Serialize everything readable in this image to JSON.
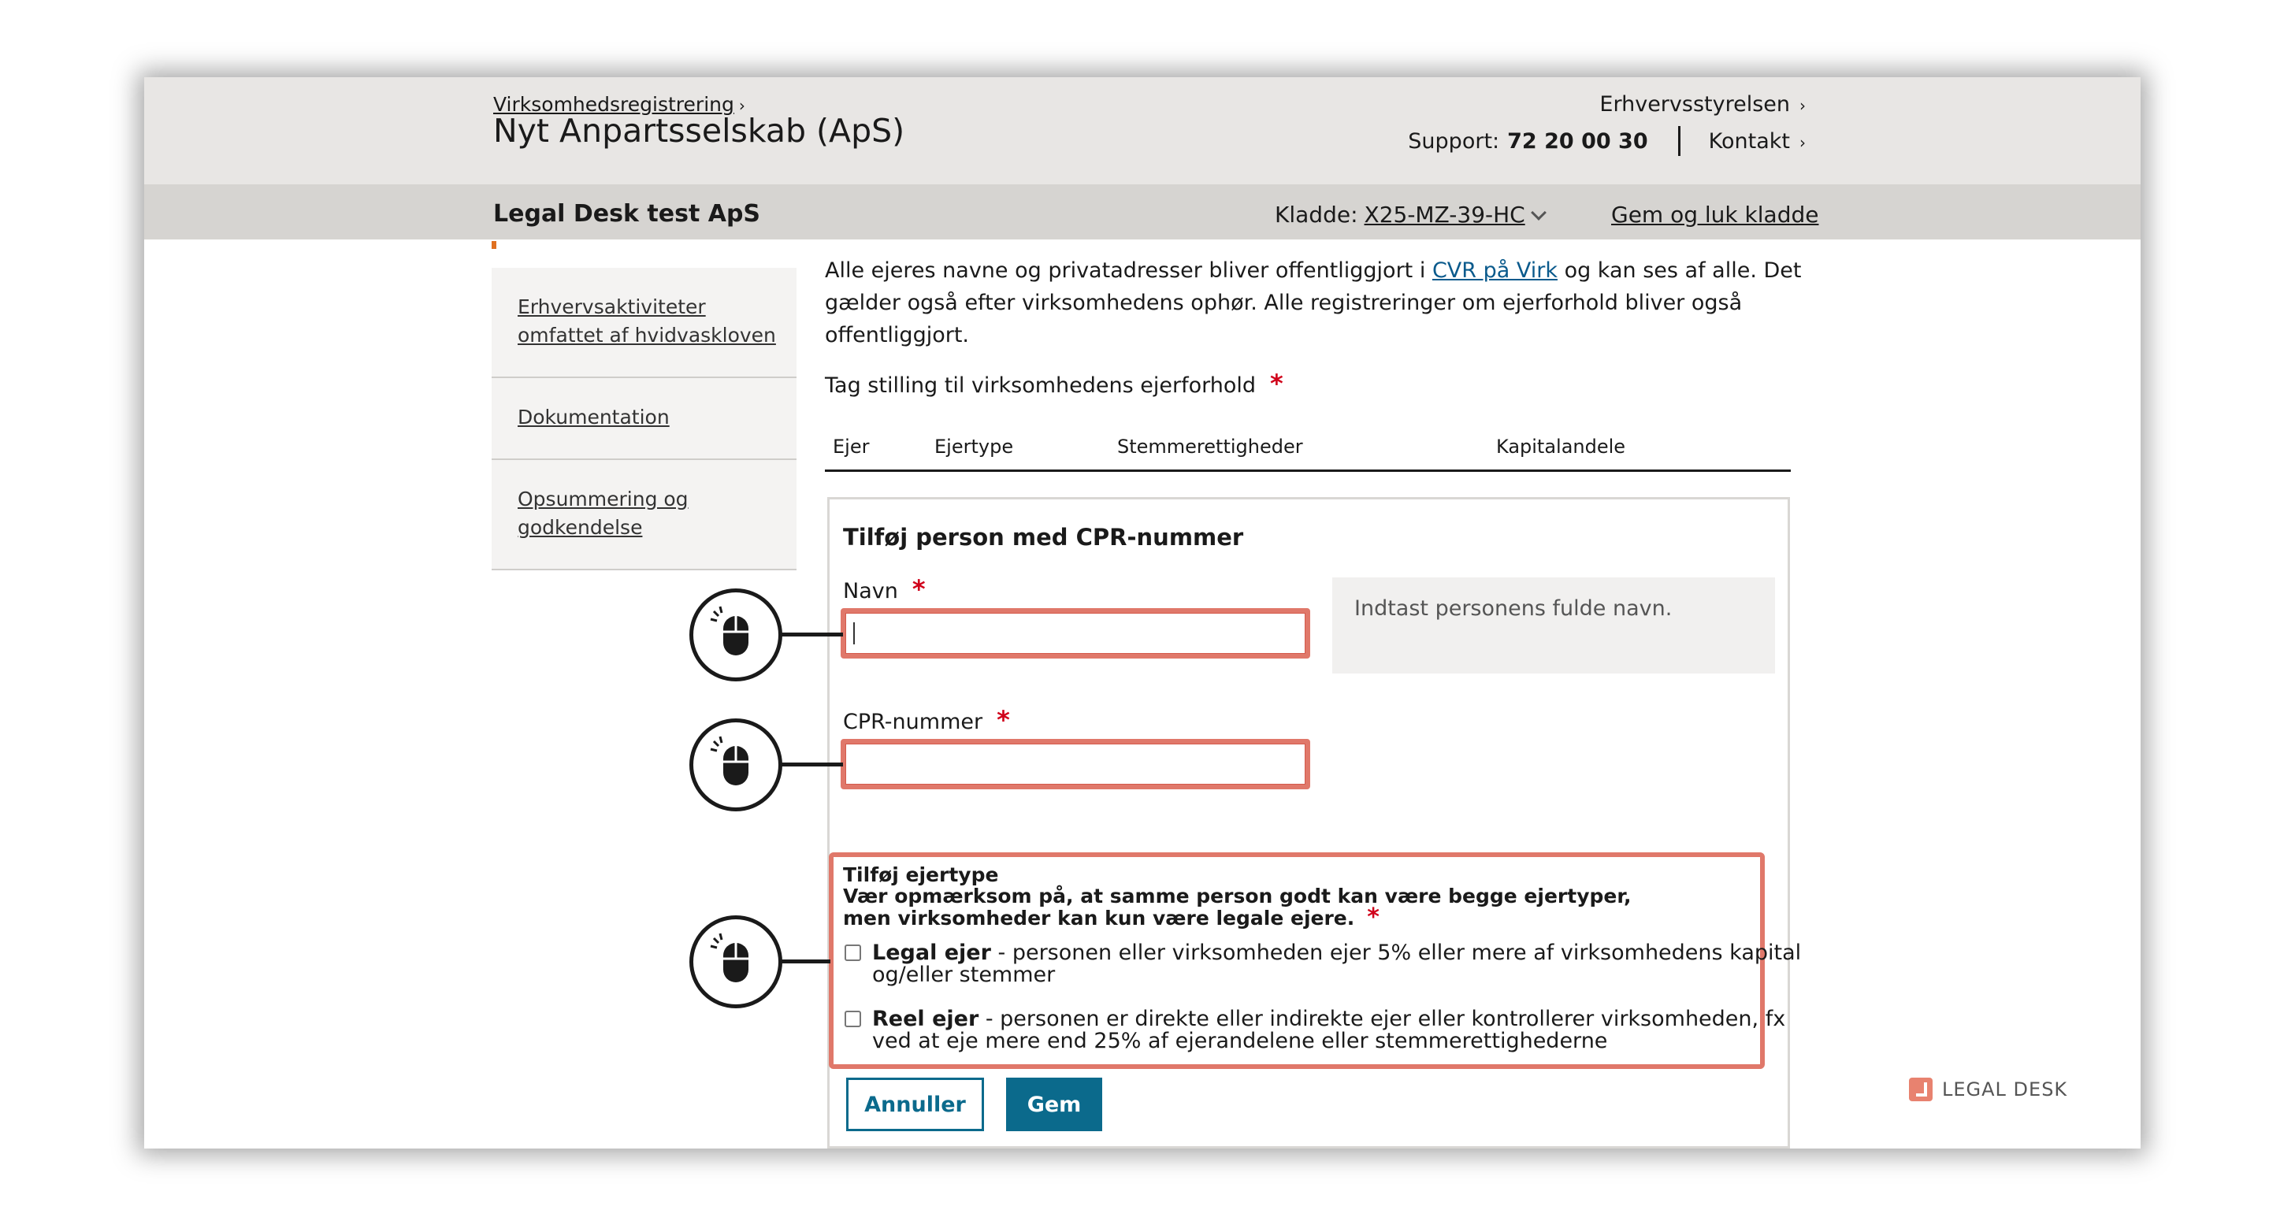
{
  "header": {
    "breadcrumb": "Virksomhedsregistrering",
    "title": "Nyt Anpartsselskab (ApS)",
    "org_link": "Erhvervsstyrelsen",
    "support_label": "Support:",
    "support_number": "72 20 00 30",
    "contact_link": "Kontakt"
  },
  "subbar": {
    "company": "Legal Desk test ApS",
    "draft_label": "Kladde:",
    "draft_code": "X25-MZ-39-HC",
    "save_close": "Gem og luk kladde"
  },
  "sidebar": {
    "items": [
      {
        "line1": "Erhvervsaktiviteter",
        "line2": "omfattet af hvidvaskloven"
      },
      {
        "line1": "Dokumentation",
        "line2": ""
      },
      {
        "line1": "Opsummering og",
        "line2": "godkendelse"
      }
    ]
  },
  "main": {
    "intro_before": "Alle ejeres navne og privatadresser bliver offentliggjort i ",
    "intro_link": "CVR på Virk",
    "intro_after_1": " og kan ses af alle. Det",
    "intro_line2": "gælder også efter virksomhedens ophør. Alle registreringer om ejerforhold bliver også",
    "intro_line3": "offentliggjort.",
    "stance_label": "Tag stilling til virksomhedens ejerforhold",
    "required_mark": "*",
    "table_headers": [
      "Ejer",
      "Ejertype",
      "Stemmerettigheder",
      "Kapitalandele"
    ]
  },
  "form": {
    "title": "Tilføj person med CPR-nummer",
    "name_label": "Navn",
    "name_value": "",
    "name_hint": "Indtast personens fulde navn.",
    "cpr_label": "CPR-nummer",
    "cpr_value": "",
    "owner_type_title": "Tilføj ejertype",
    "owner_type_note_1": "Vær opmærksom på, at samme person godt kan være begge ejertyper,",
    "owner_type_note_2": "men virksomheder kan kun være legale ejere.",
    "legal_owner_bold": "Legal ejer",
    "legal_owner_text_1": " - personen eller virksomheden ejer 5% eller mere af virksomhedens kapital",
    "legal_owner_text_2": "og/eller stemmer",
    "real_owner_bold": "Reel ejer",
    "real_owner_text_1": " - personen er direkte eller indirekte ejer eller kontrollerer virksomheden, fx",
    "real_owner_text_2": "ved at eje mere end 25% af ejerandelene eller stemmerettighederne",
    "cancel_label": "Annuller",
    "save_label": "Gem"
  },
  "brand": {
    "name": "LEGAL DESK"
  },
  "colors": {
    "accent": "#0b6a8c",
    "highlight": "#e0786a",
    "required": "#d0021b",
    "header_bg": "#e8e6e4",
    "subbar_bg": "#d6d4d1"
  }
}
